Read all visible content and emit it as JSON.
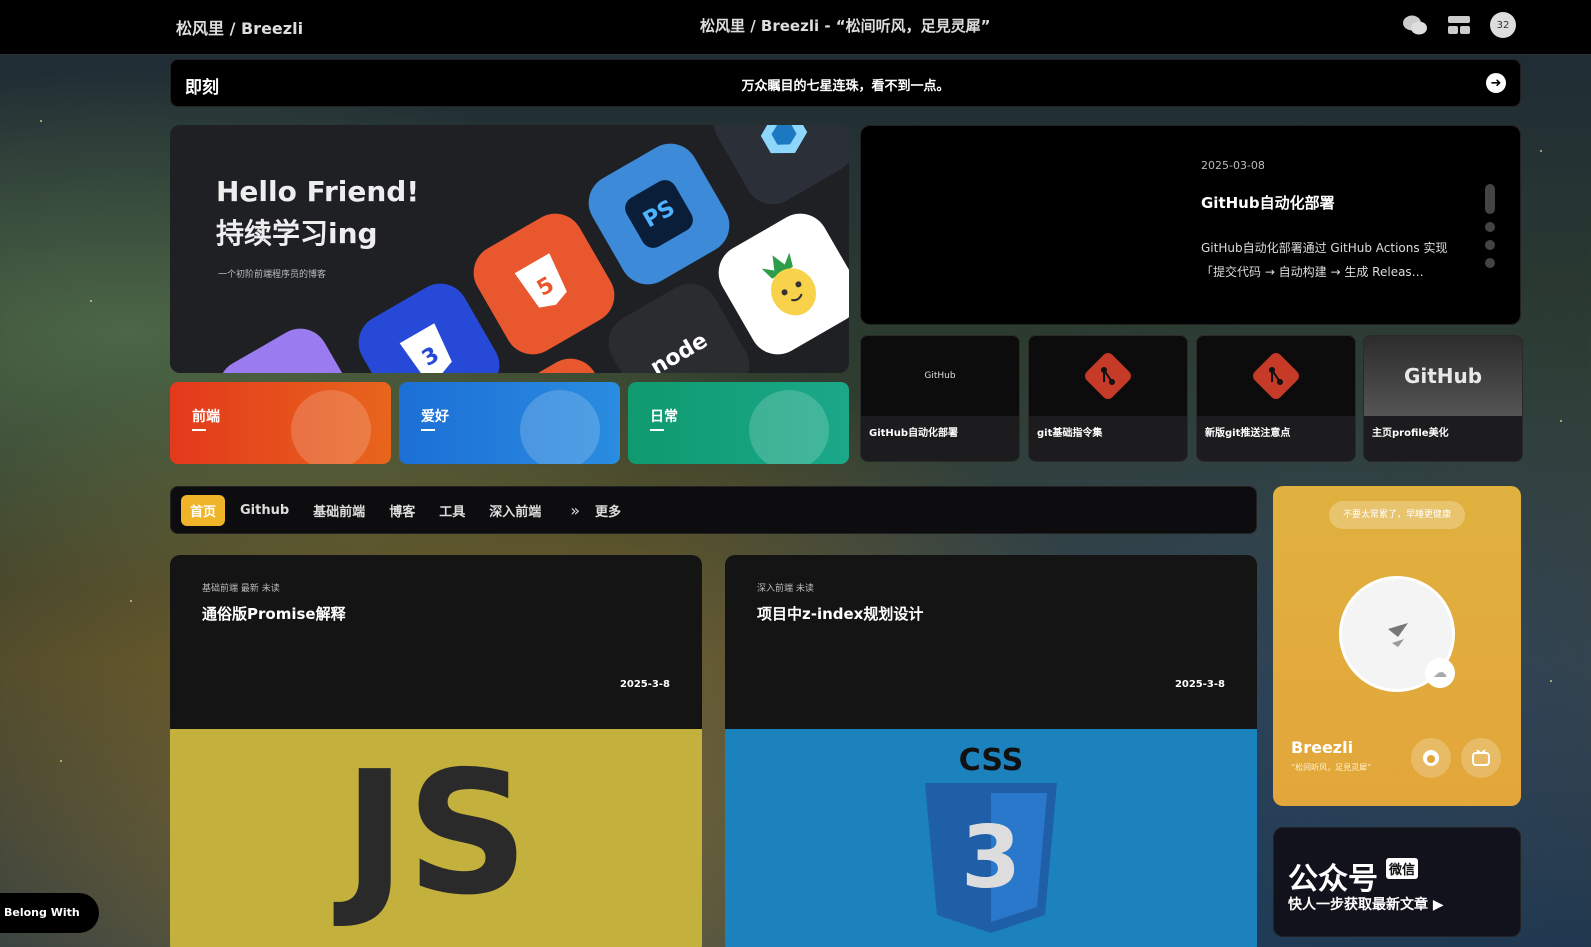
{
  "topbar": {
    "brand": "松风里 / Breezli",
    "center_title": "松风里 / Breezli - “松间听风，足見灵犀”",
    "avatar_text": "32"
  },
  "moment": {
    "label": "即刻",
    "text": "万众瞩目的七星连珠，看不到一点。"
  },
  "hero": {
    "line1": "Hello Friend!",
    "line2": "持续学习ing",
    "subtitle": "一个初阶前端程序员的博客",
    "ps_label": "PS"
  },
  "categories": [
    {
      "label": "前端",
      "color": "#e8581d"
    },
    {
      "label": "爱好",
      "color": "#1e7fd8"
    },
    {
      "label": "日常",
      "color": "#14a07c"
    }
  ],
  "featured": {
    "date": "2025-03-08",
    "title": "GitHub自动化部署",
    "description": "GitHub自动化部署通过 GitHub Actions 实现「提交代码 → 自动构建 → 生成 Releas…"
  },
  "mini_posts": [
    {
      "title": "GitHub自动化部署",
      "img_text": "GitHub"
    },
    {
      "title": "git基础指令集",
      "img_text": "git"
    },
    {
      "title": "新版git推送注意点",
      "img_text": "git"
    },
    {
      "title": "主页profile美化",
      "img_text": "GitHub"
    }
  ],
  "tabs": {
    "items": [
      "首页",
      "Github",
      "基础前端",
      "博客",
      "工具",
      "深入前端"
    ],
    "more": "更多"
  },
  "posts": [
    {
      "tags": "基础前端  最新  未读",
      "title": "通俗版Promise解释",
      "date": "2025-3-8",
      "cover_text": "JS"
    },
    {
      "tags": "深入前端  未读",
      "title": "项目中z-index规划设计",
      "date": "2025-3-8",
      "cover_text": "CSS"
    }
  ],
  "profile": {
    "pill": "不要太常累了，早睡更健康",
    "name": "Breezli",
    "quote": "“松间听风，足見灵犀”"
  },
  "wechat": {
    "title": "公众号",
    "badge": "微信",
    "subtitle": "快人一步获取最新文章 ▶"
  },
  "music": {
    "label": "Belong With Me"
  }
}
